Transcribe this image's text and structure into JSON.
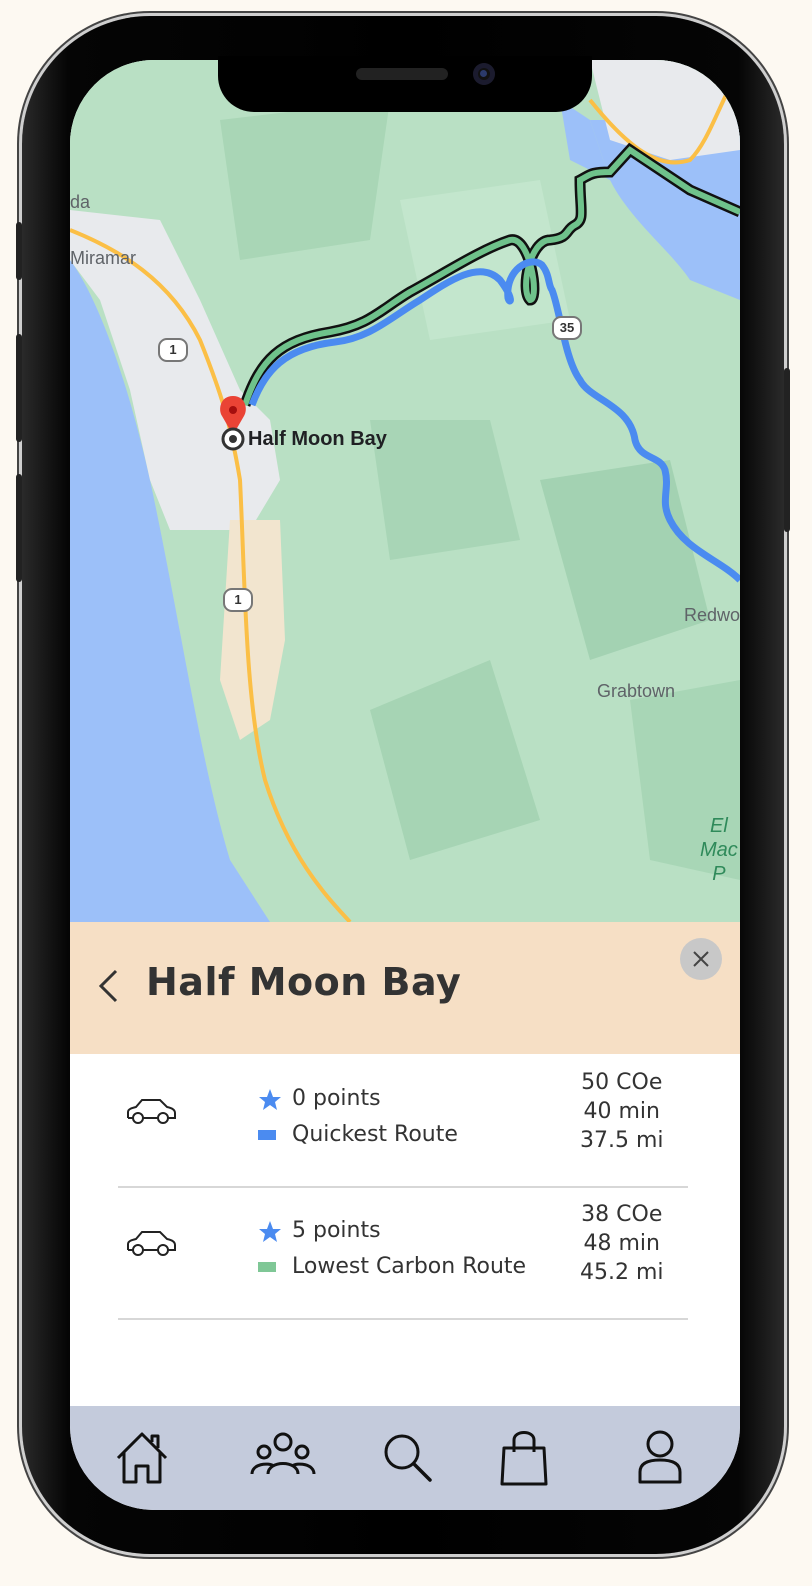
{
  "map": {
    "destination_label": "Half Moon Bay",
    "places": [
      "Miramar",
      "Redwo",
      "Grabtown",
      "da"
    ],
    "park_label": [
      "El",
      "Mac",
      "P"
    ],
    "highway_shields": [
      "1",
      "1",
      "35"
    ],
    "colors": {
      "land": "#b9e0c4",
      "water": "#9cc0f9",
      "urban": "#e8eaed",
      "sand": "#f2e5cf",
      "highway": "#fbbf46",
      "quickest_route": "#4b8bf0",
      "low_carbon_route": "#6fc28b",
      "pin": "#ea4335"
    }
  },
  "sheet": {
    "title": "Half Moon Bay",
    "routes": [
      {
        "points": "0 points",
        "name": "Quickest Route",
        "co2": "50 COe",
        "time": "40 min",
        "distance": "37.5 mi",
        "swatch_color": "#4b8bf0"
      },
      {
        "points": "5 points",
        "name": "Lowest Carbon Route",
        "co2": "38 COe",
        "time": "48 min",
        "distance": "45.2 mi",
        "swatch_color": "#7fc796"
      }
    ]
  },
  "nav": {
    "icons": [
      "home-icon",
      "community-icon",
      "search-icon",
      "shop-icon",
      "profile-icon"
    ]
  }
}
